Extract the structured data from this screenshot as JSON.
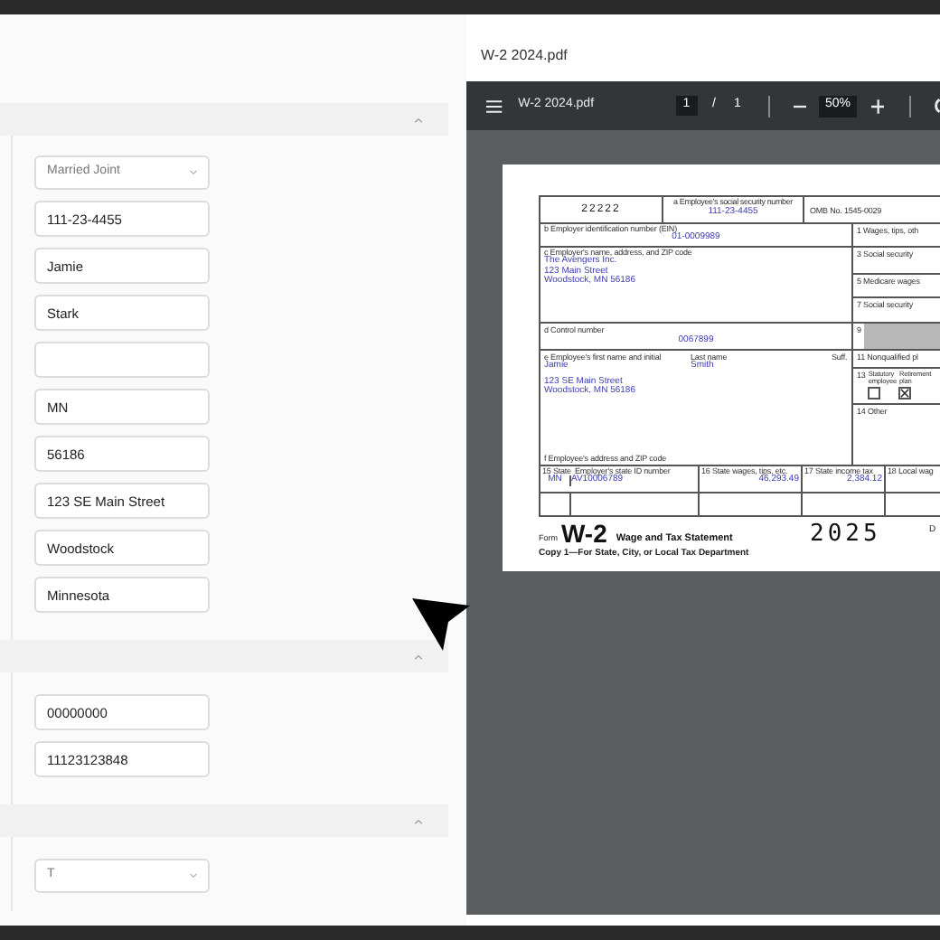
{
  "form_panel": {
    "sections": [
      {
        "expanded": true,
        "fields": [
          {
            "kind": "select",
            "value": "Married Joint"
          },
          {
            "kind": "text",
            "value": "111-23-4455"
          },
          {
            "kind": "text",
            "value": "Jamie"
          },
          {
            "kind": "text",
            "value": "Stark"
          },
          {
            "kind": "text"
          },
          {
            "kind": "text",
            "value": "MN"
          },
          {
            "kind": "text",
            "value": "56186"
          },
          {
            "kind": "text",
            "value": "123 SE Main Street"
          },
          {
            "kind": "text",
            "value": "Woodstock"
          },
          {
            "kind": "text",
            "value": "Minnesota"
          }
        ]
      },
      {
        "expanded": true,
        "fields": [
          {
            "kind": "text",
            "value": "00000000"
          },
          {
            "kind": "text",
            "value": "11123123848"
          }
        ]
      },
      {
        "expanded": true,
        "fields": [
          {
            "kind": "select",
            "value": "T"
          }
        ]
      }
    ]
  },
  "preview": {
    "title": "W-2 2024.pdf",
    "toolbar": {
      "file_name": "W-2 2024.pdf",
      "page": "1",
      "separator": "/",
      "page_count": "1",
      "zoom": "50%"
    },
    "w2": {
      "code": "22222",
      "ssn": {
        "label": "a Employee's social security number",
        "value": "111-23-4455"
      },
      "omb": "OMB No. 1545-0029",
      "ein": {
        "label": "b Employer identification number (EIN)",
        "value": "01-0009989"
      },
      "employer": {
        "label": "c Employer's name, address, and ZIP code",
        "lines": [
          "The Avengers Inc.",
          "123 Main Street",
          "Woodstock, MN 56186"
        ]
      },
      "control": {
        "label": "d Control number",
        "value": "0067899"
      },
      "employee": {
        "first_label": "e Employee's first name and initial",
        "last_label": "Last name",
        "suffix_label": "Suff.",
        "first": "Jamie",
        "last": "Smith",
        "address_lines": [
          "123 SE Main Street",
          "Woodstock, MN 56186"
        ],
        "address_label": "f Employee's address and ZIP code"
      },
      "right_boxes": [
        {
          "kind": "plain",
          "label": "1 Wages, tips, oth"
        },
        {
          "kind": "plain",
          "label": "3 Social security"
        },
        {
          "kind": "plain",
          "label": "5 Medicare wages"
        },
        {
          "kind": "plain",
          "label": "7 Social security"
        },
        {
          "kind": "shaded",
          "label": "9"
        },
        {
          "kind": "plain",
          "label": "11 Nonqualified pl"
        },
        {
          "kind": "checkboxes",
          "label": "13",
          "options": [
            {
              "label_lines": [
                "Statutory",
                "employee"
              ],
              "checked": false
            },
            {
              "label_lines": [
                "Retirement",
                "plan"
              ],
              "checked": true
            }
          ]
        },
        {
          "kind": "plain",
          "label": "14 Other"
        }
      ],
      "state_row": {
        "state_label": "15 State",
        "state_id_label": "Employer's state ID number",
        "state": "MN",
        "state_id": "AV10006789",
        "wages_label": "16 State wages, tips, etc.",
        "wages": "46,293.49",
        "tax_label": "17 State income tax",
        "tax": "2,384.12",
        "local_label": "18 Local wag"
      },
      "footer": {
        "form_word": "Form",
        "form_name": "W-2",
        "statement": "Wage and Tax Statement",
        "copy": "Copy 1—For State, City, or Local Tax Department",
        "year": "2025",
        "edge_text": "D"
      }
    }
  }
}
